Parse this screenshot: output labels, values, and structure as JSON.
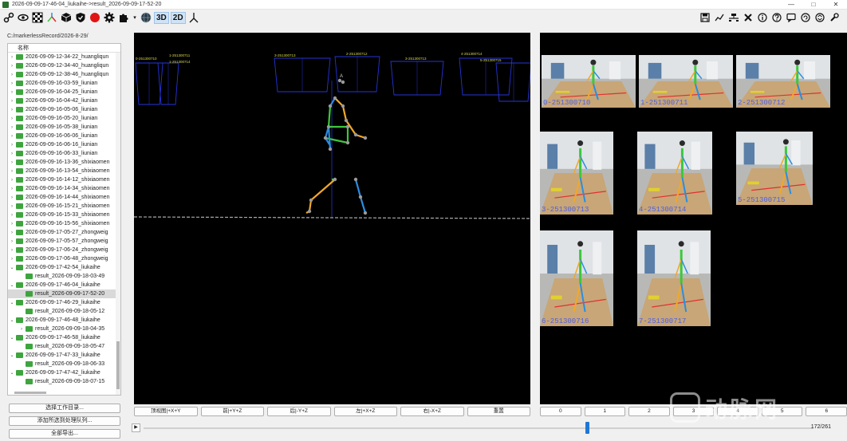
{
  "window": {
    "title": "2026-09-09-17-46-04_liukaihe->result_2026-09-09-17-52-20",
    "controls": [
      "—",
      "□",
      "✕"
    ]
  },
  "toolbar": {
    "left_icons": [
      "link-icon",
      "eye-icon",
      "checker-icon",
      "skeleton-icon",
      "cube-icon",
      "shield-icon",
      "record-icon",
      "gear-icon",
      "puzzle-icon",
      "dropdown-icon",
      "globe-icon"
    ],
    "view_3d_label": "3D",
    "view_2d_label": "2D",
    "right_icons": [
      "save-icon",
      "chart-icon",
      "rig-icon",
      "close-icon",
      "info-icon",
      "help-icon",
      "chat-icon",
      "refresh-icon",
      "sync-icon",
      "wrench-icon"
    ]
  },
  "sidebar": {
    "path": "C:/markerlessRecord/2026-8-29/",
    "header": "名称",
    "items": [
      {
        "label": "2026-09-09-12-34-22_huangliqun",
        "child": false,
        "expanded": false
      },
      {
        "label": "2026-09-09-12-34-40_huangliqun",
        "child": false,
        "expanded": false
      },
      {
        "label": "2026-09-09-12-38-46_huangliqun",
        "child": false,
        "expanded": false
      },
      {
        "label": "2026-09-09-16-03-59_liunian",
        "child": false,
        "expanded": false
      },
      {
        "label": "2026-09-09-16-04-25_liunian",
        "child": false,
        "expanded": false
      },
      {
        "label": "2026-09-09-16-04-42_liunian",
        "child": false,
        "expanded": false
      },
      {
        "label": "2026-09-09-16-05-06_liunian",
        "child": false,
        "expanded": false
      },
      {
        "label": "2026-09-09-16-05-20_liunian",
        "child": false,
        "expanded": false
      },
      {
        "label": "2026-09-09-16-05-38_liunian",
        "child": false,
        "expanded": false
      },
      {
        "label": "2026-09-09-16-06-06_liunian",
        "child": false,
        "expanded": false
      },
      {
        "label": "2026-09-09-16-06-16_liunian",
        "child": false,
        "expanded": false
      },
      {
        "label": "2026-09-09-16-06-33_liunian",
        "child": false,
        "expanded": false
      },
      {
        "label": "2026-09-09-16-13-36_shixiaomen",
        "child": false,
        "expanded": false
      },
      {
        "label": "2026-09-09-16-13-54_shixiaomen",
        "child": false,
        "expanded": false
      },
      {
        "label": "2026-09-09-16-14-12_shixiaomen",
        "child": false,
        "expanded": false
      },
      {
        "label": "2026-09-09-16-14-34_shixiaomen",
        "child": false,
        "expanded": false
      },
      {
        "label": "2026-09-09-16-14-44_shixiaomen",
        "child": false,
        "expanded": false
      },
      {
        "label": "2026-09-09-16-15-21_shixiaomen",
        "child": false,
        "expanded": false
      },
      {
        "label": "2026-09-09-16-15-33_shixiaomen",
        "child": false,
        "expanded": false
      },
      {
        "label": "2026-09-09-16-15-56_shixiaomen",
        "child": false,
        "expanded": false
      },
      {
        "label": "2026-09-09-17-05-27_zhongweig",
        "child": false,
        "expanded": false
      },
      {
        "label": "2026-09-09-17-05-57_zhongweig",
        "child": false,
        "expanded": false
      },
      {
        "label": "2026-09-09-17-06-24_zhongweig",
        "child": false,
        "expanded": false
      },
      {
        "label": "2026-09-09-17-06-48_zhongweig",
        "child": false,
        "expanded": false
      },
      {
        "label": "2026-09-09-17-42-54_liukaihe",
        "child": false,
        "expanded": true
      },
      {
        "label": "result_2026-09-09-18-03-49",
        "child": true
      },
      {
        "label": "2026-09-09-17-46-04_liukaihe",
        "child": false,
        "expanded": true
      },
      {
        "label": "result_2026-09-09-17-52-20",
        "child": true,
        "selected": true
      },
      {
        "label": "2026-09-09-17-46-29_liukaihe",
        "child": false,
        "expanded": true
      },
      {
        "label": "result_2026-09-09-18-05-12",
        "child": true
      },
      {
        "label": "2026-09-09-17-46-48_liukaihe",
        "child": false,
        "expanded": true
      },
      {
        "label": "result_2026-09-09-18-04-35",
        "child": true,
        "arrow": true
      },
      {
        "label": "2026-09-09-17-46-58_liukaihe",
        "child": false,
        "expanded": true
      },
      {
        "label": "result_2026-09-09-18-05-47",
        "child": true
      },
      {
        "label": "2026-09-09-17-47-33_liukaihe",
        "child": false,
        "expanded": true
      },
      {
        "label": "result_2026-09-09-18-06-33",
        "child": true
      },
      {
        "label": "2026-09-09-17-47-42_liukaihe",
        "child": false,
        "expanded": true
      },
      {
        "label": "result_2026-09-09-18-07-15",
        "child": true
      }
    ],
    "buttons": {
      "select_dir": "选择工作目录...",
      "add_queue": "添加所选到处理队列...",
      "export_all": "全部导出..."
    }
  },
  "view3d": {
    "camera_tags": [
      "0-251300710",
      "1-251300711",
      "1-251300714",
      "3-251300713",
      "2-251300712",
      "3-251300713",
      "4-251300714",
      "5-251300715"
    ],
    "origin_label": "A",
    "buttons": [
      "顶视图|+X+Y",
      "前|+Y+Z",
      "后|-Y+Z",
      "左|+X+Z",
      "右|-X+Z",
      "重置"
    ]
  },
  "view2d": {
    "cam_labels": [
      "0-251300710",
      "1-251300711",
      "2-251300712",
      "3-251300713",
      "4-251300714",
      "5-251300715",
      "6-251300716",
      "7-251300717"
    ],
    "buttons": [
      "0",
      "1",
      "2",
      "3",
      "4",
      "5",
      "6"
    ]
  },
  "playback": {
    "play_icon": "▶",
    "frame_counter": "172/261",
    "current_frame": 172,
    "total_frames": 261
  },
  "watermark": "动脉网",
  "colors": {
    "bone_left": "#f0a82a",
    "bone_right": "#2a8de0",
    "bone_center": "#3cc83c",
    "camera_frustum": "#2633d8"
  }
}
